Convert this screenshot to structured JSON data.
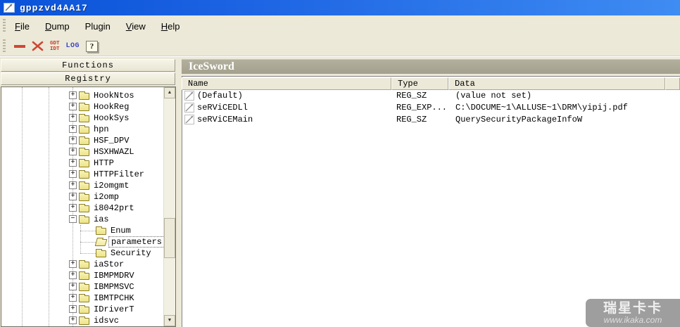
{
  "window": {
    "title": "gppzvd4AA17"
  },
  "menu_bar": {
    "items": [
      {
        "accel": "F",
        "rest": "ile"
      },
      {
        "accel": "D",
        "rest": "ump"
      },
      {
        "accel": "",
        "rest": "Plugin"
      },
      {
        "accel": "V",
        "rest": "iew"
      },
      {
        "accel": "H",
        "rest": "elp"
      }
    ]
  },
  "toolbar": {
    "gdt_label": "GDT",
    "idt_label": "IDT",
    "log_label": "LOG",
    "help_glyph": "?"
  },
  "left_panel": {
    "functions_button": "Functions",
    "registry_button": "Registry",
    "tree": {
      "items": [
        {
          "label": "HookNtos",
          "level": 0,
          "expand": "plus"
        },
        {
          "label": "HookReg",
          "level": 0,
          "expand": "plus"
        },
        {
          "label": "HookSys",
          "level": 0,
          "expand": "plus"
        },
        {
          "label": "hpn",
          "level": 0,
          "expand": "plus"
        },
        {
          "label": "HSF_DPV",
          "level": 0,
          "expand": "plus"
        },
        {
          "label": "HSXHWAZL",
          "level": 0,
          "expand": "plus"
        },
        {
          "label": "HTTP",
          "level": 0,
          "expand": "plus"
        },
        {
          "label": "HTTPFilter",
          "level": 0,
          "expand": "plus"
        },
        {
          "label": "i2omgmt",
          "level": 0,
          "expand": "plus"
        },
        {
          "label": "i2omp",
          "level": 0,
          "expand": "plus"
        },
        {
          "label": "i8042prt",
          "level": 0,
          "expand": "plus"
        },
        {
          "label": "ias",
          "level": 0,
          "expand": "minus"
        },
        {
          "label": "Enum",
          "level": 1,
          "expand": "none"
        },
        {
          "label": "parameters",
          "level": 1,
          "expand": "none",
          "selected": true,
          "open": true
        },
        {
          "label": "Security",
          "level": 1,
          "expand": "none"
        },
        {
          "label": "iaStor",
          "level": 0,
          "expand": "plus"
        },
        {
          "label": "IBMPMDRV",
          "level": 0,
          "expand": "plus"
        },
        {
          "label": "IBMPMSVC",
          "level": 0,
          "expand": "plus"
        },
        {
          "label": "IBMTPCHK",
          "level": 0,
          "expand": "plus"
        },
        {
          "label": "IDriverT",
          "level": 0,
          "expand": "plus"
        },
        {
          "label": "idsvc",
          "level": 0,
          "expand": "plus"
        }
      ]
    }
  },
  "right_panel": {
    "title": "IceSword",
    "table": {
      "columns": [
        "Name",
        "Type",
        "Data"
      ],
      "rows": [
        {
          "name": "(Default)",
          "type": "REG_SZ",
          "data": "(value not set)"
        },
        {
          "name": "seRViCEDLl",
          "type": "REG_EXP...",
          "data": "C:\\DOCUME~1\\ALLUSE~1\\DRM\\yipij.pdf"
        },
        {
          "name": "seRViCEMain",
          "type": "REG_SZ",
          "data": "QuerySecurityPackageInfoW"
        }
      ]
    }
  },
  "watermark": {
    "brand": "瑞星卡卡",
    "url": "www.ikaka.com"
  },
  "colors": {
    "titlebar_blue_start": "#0a52d8",
    "titlebar_blue_end": "#3f8cf3",
    "chrome_beige": "#ece9d8",
    "toolbar_red": "#cf4734",
    "toolbar_blue": "#4046c8",
    "panel_header_taupe": "#a8a693",
    "folder_yellow": "#f0e898"
  }
}
